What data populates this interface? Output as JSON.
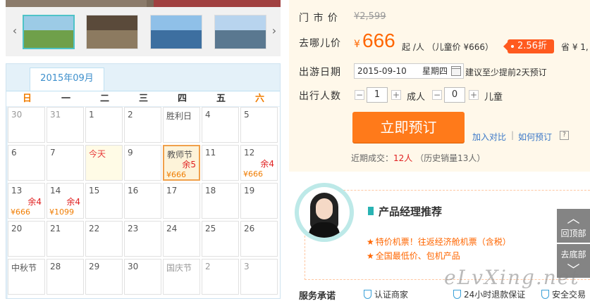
{
  "gallery": {
    "prev_icon": "chevron-left-icon",
    "next_icon": "chevron-right-icon",
    "thumbs": [
      "thumb-1",
      "thumb-2",
      "thumb-3",
      "thumb-4"
    ]
  },
  "calendar": {
    "month": "2015年09月",
    "weekdays": [
      "日",
      "一",
      "二",
      "三",
      "四",
      "五",
      "六"
    ],
    "days": [
      {
        "d": "30",
        "style": "muted"
      },
      {
        "d": "31",
        "style": "muted"
      },
      {
        "d": "1",
        "style": "dark"
      },
      {
        "d": "2",
        "style": "dark"
      },
      {
        "d": "胜利日",
        "style": "dark"
      },
      {
        "d": "4",
        "style": "dark"
      },
      {
        "d": "5",
        "style": "dark"
      },
      {
        "d": "6",
        "style": "dark"
      },
      {
        "d": "7",
        "style": "dark"
      },
      {
        "d": "今天",
        "style": "today"
      },
      {
        "d": "9",
        "style": "dark"
      },
      {
        "d": "教师节",
        "style": "selected",
        "rem": "余5",
        "price": "¥666"
      },
      {
        "d": "11",
        "style": "dark"
      },
      {
        "d": "12",
        "style": "dark",
        "rem": "余4",
        "price": "¥666"
      },
      {
        "d": "13",
        "style": "dark",
        "rem": "余4",
        "price": "¥666"
      },
      {
        "d": "14",
        "style": "dark",
        "rem": "余4",
        "price": "¥1099"
      },
      {
        "d": "15",
        "style": "dark"
      },
      {
        "d": "16",
        "style": "dark"
      },
      {
        "d": "17",
        "style": "dark"
      },
      {
        "d": "18",
        "style": "dark"
      },
      {
        "d": "19",
        "style": "dark"
      },
      {
        "d": "20",
        "style": "dark"
      },
      {
        "d": "21",
        "style": "dark"
      },
      {
        "d": "22",
        "style": "dark"
      },
      {
        "d": "23",
        "style": "dark"
      },
      {
        "d": "24",
        "style": "dark"
      },
      {
        "d": "25",
        "style": "dark"
      },
      {
        "d": "26",
        "style": "dark"
      },
      {
        "d": "中秋节",
        "style": "dark"
      },
      {
        "d": "28",
        "style": "dark"
      },
      {
        "d": "29",
        "style": "dark"
      },
      {
        "d": "30",
        "style": "dark"
      },
      {
        "d": "国庆节",
        "style": "muted"
      },
      {
        "d": "2",
        "style": "muted"
      },
      {
        "d": "3",
        "style": "muted"
      }
    ]
  },
  "info": {
    "orig_price_label": "门 市 价",
    "orig_price": "¥2,599",
    "price_label": "去哪儿价",
    "yen": "¥",
    "price": "666",
    "price_suffix": "起 /人 （儿童价 ¥666）",
    "discount": "2.56折",
    "save_text": "省 ¥ 1,",
    "date_label": "出游日期",
    "date_value": "2015-09-10",
    "weekday": "星期四",
    "date_hint": "建议至少提前2天预订",
    "people_label": "出行人数",
    "adult_qty": "1",
    "adult_label": "成人",
    "child_qty": "0",
    "child_label": "儿童",
    "minus": "−",
    "plus": "+",
    "book_button": "立即预订",
    "compare_link": "加入对比",
    "sep": "|",
    "howto_link": "如何预订",
    "help": "?",
    "recent_prefix": "近期成交：",
    "recent_count": "12人",
    "recent_suffix": "（历史销量13人）"
  },
  "manager": {
    "title": "产品经理推荐",
    "items": [
      "特价机票！往返经济舱机票（含税）",
      "全国最低价、包机产品"
    ]
  },
  "service": {
    "label": "服务承诺",
    "items": [
      "认证商家",
      "24小时退款保证",
      "安全交易"
    ]
  },
  "side": {
    "top_label": "回顶部",
    "bottom_label": "去底部",
    "up_icon": "arrow-up-icon",
    "down_icon": "arrow-down-icon"
  },
  "watermark": "eLvXing.net",
  "colors": {
    "accent_orange": "#ff6600",
    "book_orange": "#ff7a1a",
    "badge_red": "#ff5a1f",
    "calendar_blue": "#3d8fcc",
    "teal": "#29b3b3"
  }
}
